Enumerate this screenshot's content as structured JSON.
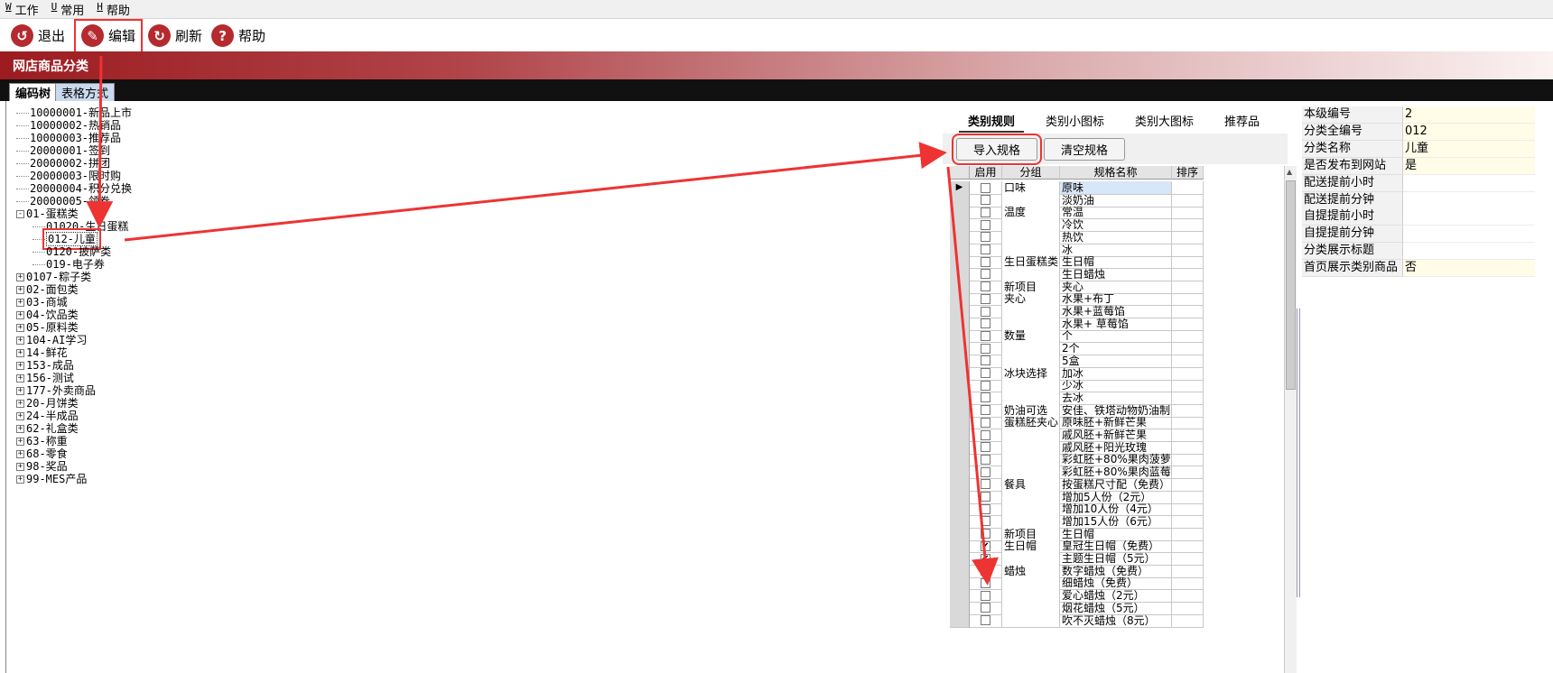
{
  "menu": [
    {
      "key": "W",
      "label": "工作"
    },
    {
      "key": "U",
      "label": "常用"
    },
    {
      "key": "H",
      "label": "帮助"
    }
  ],
  "toolbar": {
    "exit": "退出",
    "edit": "编辑",
    "refresh": "刷新",
    "help": "帮助"
  },
  "title": "网店商品分类",
  "tabs": [
    "编码树",
    "表格方式"
  ],
  "tree": [
    {
      "label": "10000001-新品上市",
      "level": 0,
      "box": ""
    },
    {
      "label": "10000002-热销品",
      "level": 0,
      "box": ""
    },
    {
      "label": "10000003-推荐品",
      "level": 0,
      "box": ""
    },
    {
      "label": "20000001-签到",
      "level": 0,
      "box": ""
    },
    {
      "label": "20000002-拼团",
      "level": 0,
      "box": ""
    },
    {
      "label": "20000003-限时购",
      "level": 0,
      "box": ""
    },
    {
      "label": "20000004-积分兑换",
      "level": 0,
      "box": ""
    },
    {
      "label": "20000005-领券",
      "level": 0,
      "box": ""
    },
    {
      "label": "01-蛋糕类",
      "level": 0,
      "box": "-"
    },
    {
      "label": "01020-生日蛋糕",
      "level": 1,
      "box": ""
    },
    {
      "label": "012-儿童",
      "level": 1,
      "box": "",
      "selected": true
    },
    {
      "label": "0120-披萨类",
      "level": 1,
      "box": ""
    },
    {
      "label": "019-电子券",
      "level": 1,
      "box": ""
    },
    {
      "label": "0107-粽子类",
      "level": 0,
      "box": "+"
    },
    {
      "label": "02-面包类",
      "level": 0,
      "box": "+"
    },
    {
      "label": "03-商城",
      "level": 0,
      "box": "+"
    },
    {
      "label": "04-饮品类",
      "level": 0,
      "box": "+"
    },
    {
      "label": "05-原料类",
      "level": 0,
      "box": "+"
    },
    {
      "label": "104-AI学习",
      "level": 0,
      "box": "+"
    },
    {
      "label": "14-鲜花",
      "level": 0,
      "box": "+"
    },
    {
      "label": "153-成品",
      "level": 0,
      "box": "+"
    },
    {
      "label": "156-测试",
      "level": 0,
      "box": "+"
    },
    {
      "label": "177-外卖商品",
      "level": 0,
      "box": "+"
    },
    {
      "label": "20-月饼类",
      "level": 0,
      "box": "+"
    },
    {
      "label": "24-半成品",
      "level": 0,
      "box": "+"
    },
    {
      "label": "62-礼盒类",
      "level": 0,
      "box": "+"
    },
    {
      "label": "63-称重",
      "level": 0,
      "box": "+"
    },
    {
      "label": "68-零食",
      "level": 0,
      "box": "+"
    },
    {
      "label": "98-奖品",
      "level": 0,
      "box": "+"
    },
    {
      "label": "99-MES产品",
      "level": 0,
      "box": "+"
    }
  ],
  "right_tabs": [
    "类别规则",
    "类别小图标",
    "类别大图标",
    "推荐品"
  ],
  "spec_buttons": {
    "import": "导入规格",
    "clear": "清空规格"
  },
  "grid": {
    "headers": [
      "启用",
      "分组",
      "规格名称",
      "排序"
    ],
    "rows": [
      {
        "group": "口味",
        "name": "原味",
        "checked": false
      },
      {
        "group": "",
        "name": "淡奶油",
        "checked": false
      },
      {
        "group": "温度",
        "name": "常温",
        "checked": false
      },
      {
        "group": "",
        "name": "冷饮",
        "checked": false
      },
      {
        "group": "",
        "name": "热饮",
        "checked": false
      },
      {
        "group": "",
        "name": "冰",
        "checked": false
      },
      {
        "group": "生日蛋糕类",
        "name": "生日帽",
        "checked": false
      },
      {
        "group": "",
        "name": "生日蜡烛",
        "checked": false
      },
      {
        "group": "新项目",
        "name": "夹心",
        "checked": false
      },
      {
        "group": "夹心",
        "name": "水果+布丁",
        "checked": false
      },
      {
        "group": "",
        "name": "水果+蓝莓馅",
        "checked": false
      },
      {
        "group": "",
        "name": "水果+ 草莓馅",
        "checked": false
      },
      {
        "group": "数量",
        "name": "个",
        "checked": false
      },
      {
        "group": "",
        "name": "2个",
        "checked": false
      },
      {
        "group": "",
        "name": "5盒",
        "checked": false
      },
      {
        "group": "冰块选择",
        "name": "加冰",
        "checked": false
      },
      {
        "group": "",
        "name": "少冰",
        "checked": false
      },
      {
        "group": "",
        "name": "去冰",
        "checked": false
      },
      {
        "group": "奶油可选",
        "name": "安佳、铁塔动物奶油制",
        "checked": false
      },
      {
        "group": "蛋糕胚夹心",
        "name": "原味胚+新鲜芒果",
        "checked": false
      },
      {
        "group": "",
        "name": "戚风胚+新鲜芒果",
        "checked": false
      },
      {
        "group": "",
        "name": "戚风胚+阳光玫瑰",
        "checked": false
      },
      {
        "group": "",
        "name": "彩虹胚+80%果肉菠萝",
        "checked": false
      },
      {
        "group": "",
        "name": "彩虹胚+80%果肉蓝莓",
        "checked": false
      },
      {
        "group": "餐具",
        "name": "按蛋糕尺寸配（免费）",
        "checked": false
      },
      {
        "group": "",
        "name": "增加5人份（2元）",
        "checked": false
      },
      {
        "group": "",
        "name": "增加10人份（4元）",
        "checked": false
      },
      {
        "group": "",
        "name": "增加15人份（6元）",
        "checked": false
      },
      {
        "group": "新项目",
        "name": "生日帽",
        "checked": false
      },
      {
        "group": "生日帽",
        "name": "皇冠生日帽（免费）",
        "checked": true
      },
      {
        "group": "",
        "name": "主题生日帽（5元）",
        "checked": true
      },
      {
        "group": "蜡烛",
        "name": "数字蜡烛（免费）",
        "checked": false
      },
      {
        "group": "",
        "name": "细蜡烛（免费）",
        "checked": false
      },
      {
        "group": "",
        "name": "爱心蜡烛（2元）",
        "checked": false
      },
      {
        "group": "",
        "name": "烟花蜡烛（5元）",
        "checked": false
      },
      {
        "group": "",
        "name": "吹不灭蜡烛（8元）",
        "checked": false
      }
    ]
  },
  "properties": [
    {
      "key": "本级编号",
      "value": "2"
    },
    {
      "key": "分类全编号",
      "value": "012"
    },
    {
      "key": "分类名称",
      "value": "儿童"
    },
    {
      "key": "是否发布到网站",
      "value": "是"
    },
    {
      "key": "配送提前小时",
      "value": ""
    },
    {
      "key": "配送提前分钟",
      "value": ""
    },
    {
      "key": "自提提前小时",
      "value": ""
    },
    {
      "key": "自提提前分钟",
      "value": ""
    },
    {
      "key": "分类展示标题",
      "value": ""
    },
    {
      "key": "首页展示类别商品",
      "value": "否"
    }
  ],
  "colors": {
    "brand": "#9c1c20",
    "annotation": "#ee3333",
    "selection": "#d7e6f8"
  }
}
